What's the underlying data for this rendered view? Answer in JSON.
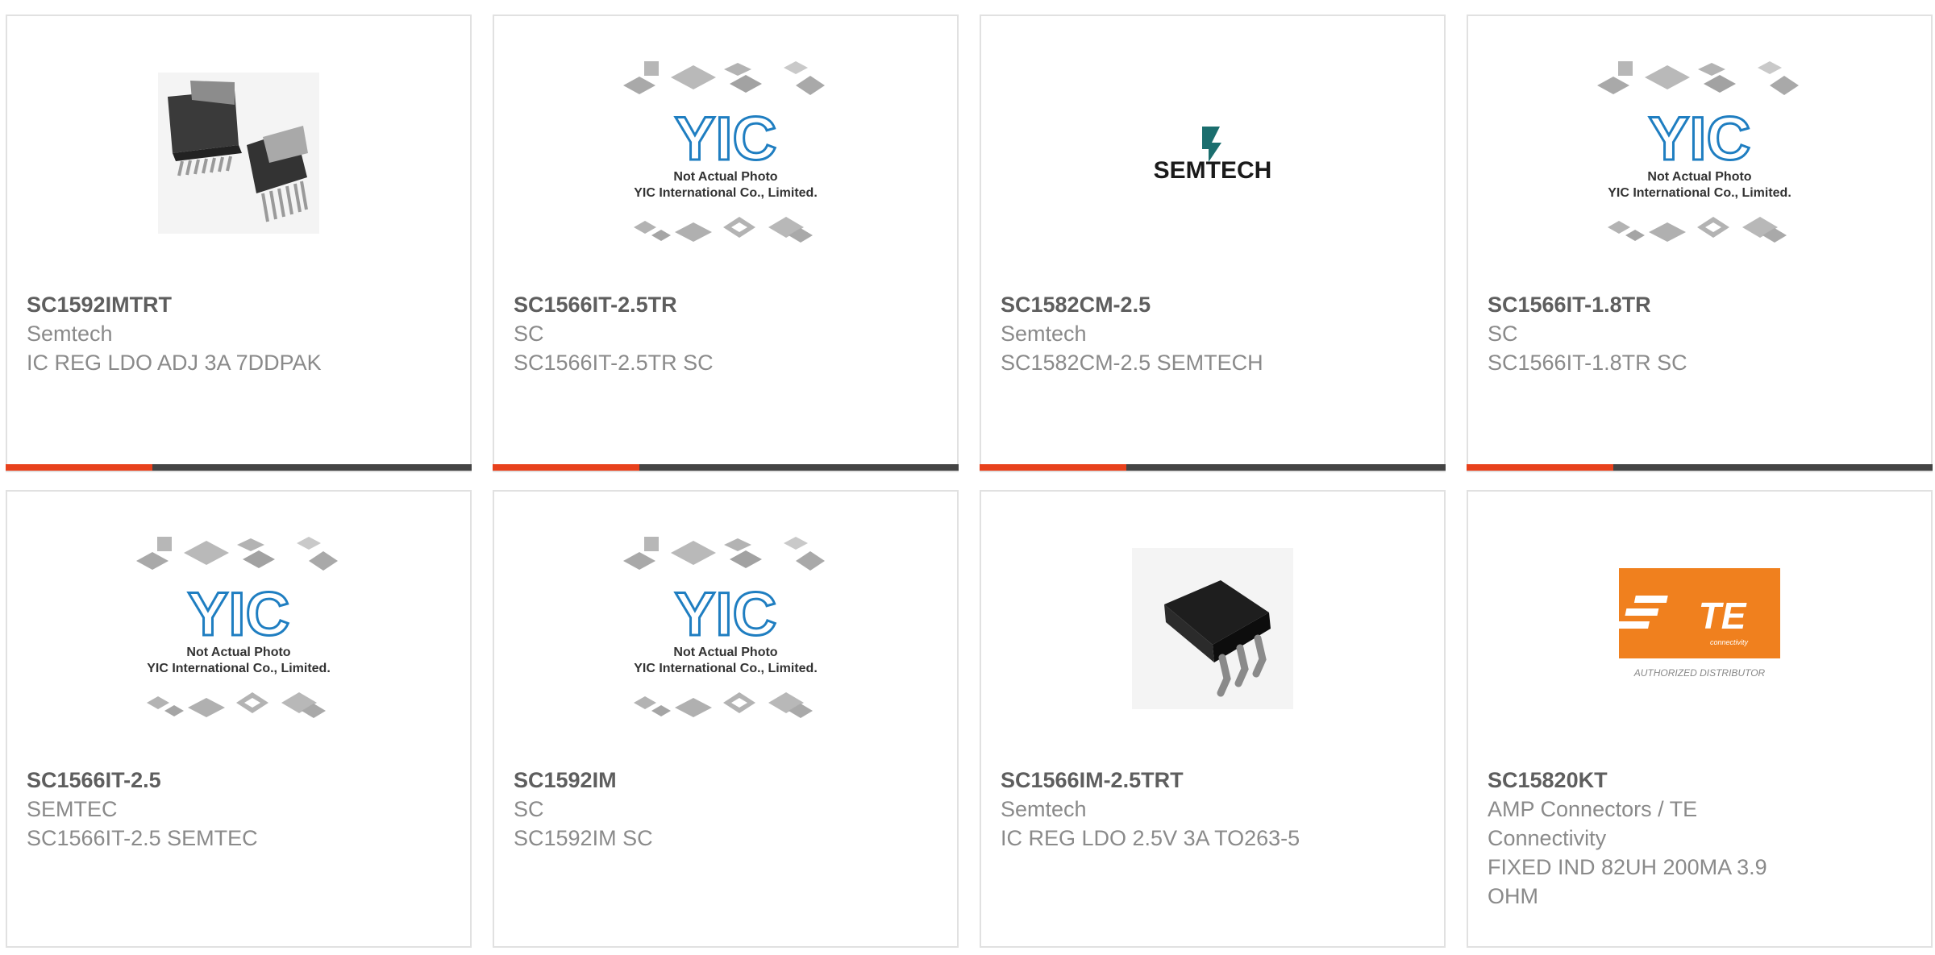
{
  "products": [
    {
      "part": "SC1592IMTRT",
      "manufacturer": "Semtech",
      "description": "IC REG LDO ADJ 3A 7DDPAK",
      "image": "ddpak-photo"
    },
    {
      "part": "SC1566IT-2.5TR",
      "manufacturer": "SC",
      "description": "SC1566IT-2.5TR SC",
      "image": "yic-placeholder"
    },
    {
      "part": "SC1582CM-2.5",
      "manufacturer": "Semtech",
      "description": "SC1582CM-2.5 SEMTECH",
      "image": "semtech-logo"
    },
    {
      "part": "SC1566IT-1.8TR",
      "manufacturer": "SC",
      "description": "SC1566IT-1.8TR SC",
      "image": "yic-placeholder"
    },
    {
      "part": "SC1566IT-2.5",
      "manufacturer": "SEMTEC",
      "description": "SC1566IT-2.5 SEMTEC",
      "image": "yic-placeholder"
    },
    {
      "part": "SC1592IM",
      "manufacturer": "SC",
      "description": "SC1592IM SC",
      "image": "yic-placeholder"
    },
    {
      "part": "SC1566IM-2.5TRT",
      "manufacturer": "Semtech",
      "description": "IC REG LDO 2.5V 3A TO263-5",
      "image": "to263-photo"
    },
    {
      "part": "SC15820KT",
      "manufacturer": "AMP Connectors / TE Connectivity",
      "description": "FIXED IND 82UH 200MA 3.9 OHM",
      "image": "te-logo"
    }
  ],
  "placeholder": {
    "line1": "Not Actual Photo",
    "line2": "YIC International Co., Limited.",
    "logo": "YIC"
  },
  "semtech_logo": "SEMTECH",
  "te_logo": {
    "text": "TE",
    "sub": "connectivity",
    "caption": "AUTHORIZED DISTRIBUTOR"
  },
  "colors": {
    "accent": "#e8411c",
    "bar": "#444444",
    "te_orange": "#f0801e",
    "yic_blue": "#1f7ec1"
  }
}
